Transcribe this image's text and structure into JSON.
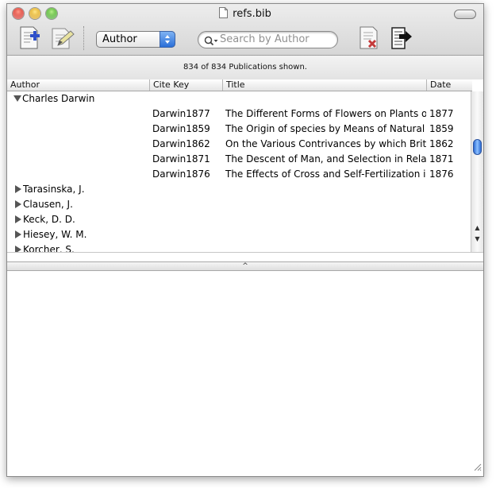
{
  "window": {
    "title": "refs.bib"
  },
  "toolbar": {
    "new_pub_icon": "new-publication-icon",
    "edit_icon": "edit-pencil-icon",
    "group_by_value": "Author",
    "search_placeholder": "Search by Author",
    "delete_icon": "delete-publication-icon",
    "export_icon": "export-icon"
  },
  "status": {
    "text": "834 of 834 Publications shown."
  },
  "table": {
    "headers": {
      "author": "Author",
      "cite_key": "Cite Key",
      "title": "Title",
      "date": "Date"
    },
    "groups": [
      {
        "author": "Charles Darwin",
        "expanded": true,
        "rows": [
          {
            "cite_key": "Darwin1877",
            "title": "The Different Forms of Flowers on Plants of",
            "date": "1877"
          },
          {
            "cite_key": "Darwin1859",
            "title": "The Origin of species by Means of Natural S",
            "date": "1859"
          },
          {
            "cite_key": "Darwin1862",
            "title": "On the Various Contrivances by which Britis",
            "date": "1862"
          },
          {
            "cite_key": "Darwin1871",
            "title": "The Descent of Man, and Selection in Relati",
            "date": "1871"
          },
          {
            "cite_key": "Darwin1876",
            "title": "The Effects of Cross and Self-Fertilization in",
            "date": "1876"
          }
        ]
      },
      {
        "author": "Tarasinska, J.",
        "expanded": false
      },
      {
        "author": "Clausen, J.",
        "expanded": false
      },
      {
        "author": "Keck, D. D.",
        "expanded": false
      },
      {
        "author": "Hiesey, W. M.",
        "expanded": false
      },
      {
        "author": "Korcher, S.",
        "expanded": false
      }
    ]
  },
  "colors": {
    "accent": "#2d6cd4"
  }
}
